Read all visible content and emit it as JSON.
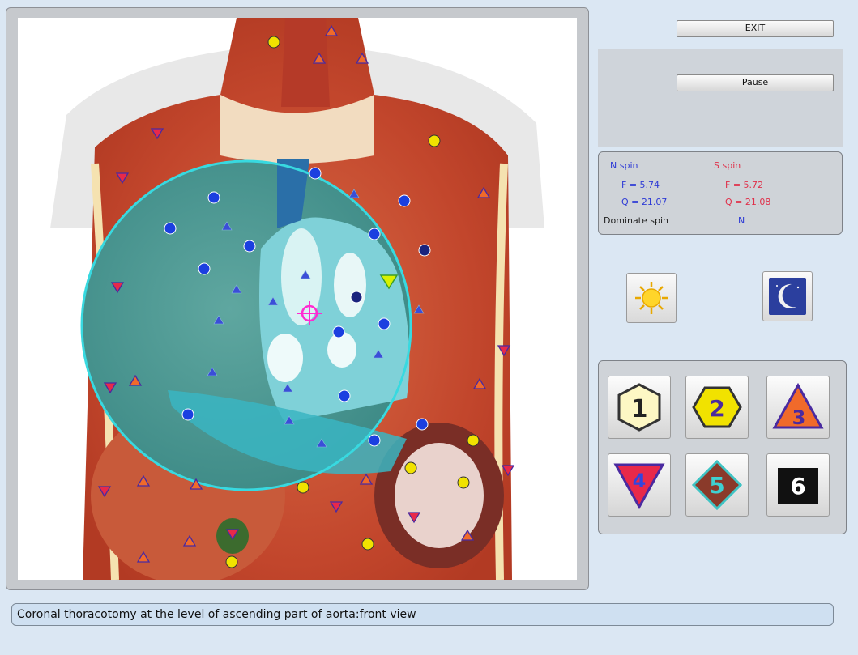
{
  "controls": {
    "exit_label": "EXIT",
    "pause_label": "Pause"
  },
  "spin": {
    "n_header": "N spin",
    "s_header": "S spin",
    "n_f": "F =  5.74",
    "n_q": "Q = 21.07",
    "s_f": "F =  5.72",
    "s_q": "Q = 21.08",
    "dominate_label": "Dominate spin",
    "dominate_value": "N"
  },
  "modes": [
    {
      "name": "day",
      "icon": "sun-icon"
    },
    {
      "name": "night",
      "icon": "moon-icon"
    }
  ],
  "shape_buttons": [
    {
      "label": "1",
      "icon": "hexagon-icon",
      "fill": "#fdf7c4"
    },
    {
      "label": "2",
      "icon": "hexagon-icon",
      "fill": "#f1e200"
    },
    {
      "label": "3",
      "icon": "triangle-up-icon",
      "fill": "#f06a2a"
    },
    {
      "label": "4",
      "icon": "triangle-down-icon",
      "fill": "#e8294a"
    },
    {
      "label": "5",
      "icon": "diamond-icon",
      "fill": "#8a3a2a"
    },
    {
      "label": "6",
      "icon": "square-icon",
      "fill": "#111111"
    }
  ],
  "caption": "Coronal thoracotomy at the level of ascending part of aorta:front view",
  "colors": {
    "background": "#dbe7f3",
    "n_spin": "#2e3bd6",
    "s_spin": "#e0304a",
    "scan_circle": "#38d9e0"
  }
}
